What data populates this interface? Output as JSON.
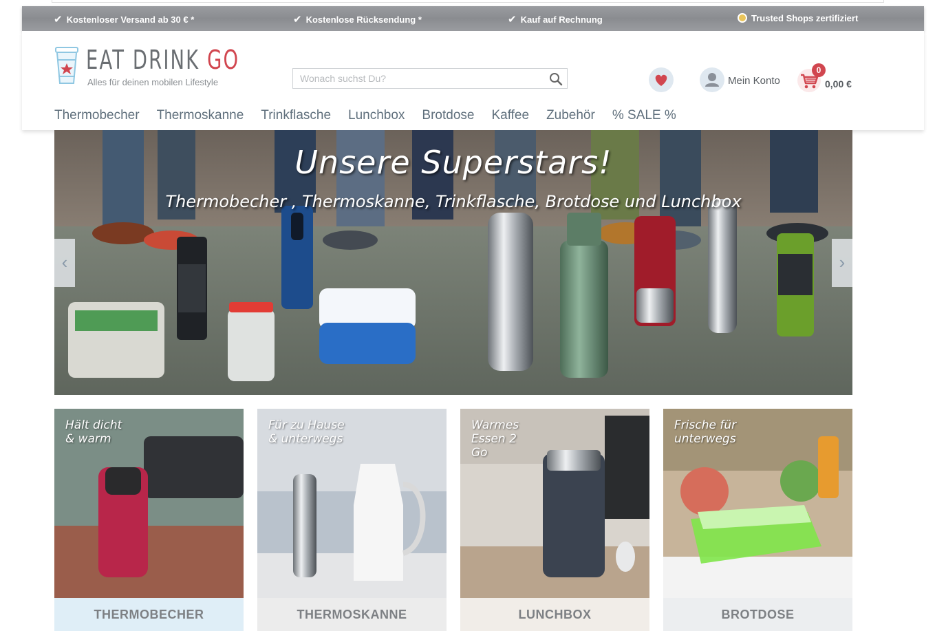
{
  "usp_bar": {
    "items": [
      {
        "icon": "check-icon",
        "text": "Kostenloser Versand ab 30 € *"
      },
      {
        "icon": "check-icon",
        "text": "Kostenlose Rücksendung *"
      },
      {
        "icon": "check-icon",
        "text": "Kauf auf Rechnung"
      },
      {
        "icon": "trusted-shops-icon",
        "text": "Trusted Shops zertifiziert"
      }
    ]
  },
  "logo": {
    "title_main": "EAT DRINK ",
    "title_accent": "GO",
    "subtitle": "Alles für deinen mobilen Lifestyle",
    "icon": "coffee-cup-icon"
  },
  "search": {
    "placeholder": "Wonach suchst Du?",
    "icon": "search-icon"
  },
  "header_actions": {
    "wishlist_icon": "heart-icon",
    "account_icon": "user-icon",
    "account_label": "Mein Konto",
    "cart_icon": "cart-icon",
    "cart_count": "0",
    "cart_total": "0,00 €"
  },
  "nav": {
    "items": [
      "Thermobecher",
      "Thermoskanne",
      "Trinkflasche",
      "Lunchbox",
      "Brotdose",
      "Kaffee",
      "Zubehör",
      "% SALE %"
    ]
  },
  "hero": {
    "title": "Unsere Superstars!",
    "subtitle": "Thermobecher , Thermoskanne, Trinkflasche, Brotdose und Lunchbox",
    "prev_icon": "chevron-left-icon",
    "next_icon": "chevron-right-icon"
  },
  "tiles": [
    {
      "tag": "Hält dicht\n& warm",
      "label": "THERMOBECHER",
      "label_bg": "#dfeef7"
    },
    {
      "tag": "Für zu Hause\n& unterwegs",
      "label": "THERMOSKANNE",
      "label_bg": "#ececec"
    },
    {
      "tag": "Warmes\nEssen 2\nGo",
      "label": "LUNCHBOX",
      "label_bg": "#f1ede8"
    },
    {
      "tag": "Frische für\nunterwegs",
      "label": "BROTDOSE",
      "label_bg": "#eceef0"
    }
  ],
  "colors": {
    "accent_red": "#d1464f",
    "nav_text": "#5f6f7c",
    "usp_bar": "#8e9094"
  }
}
